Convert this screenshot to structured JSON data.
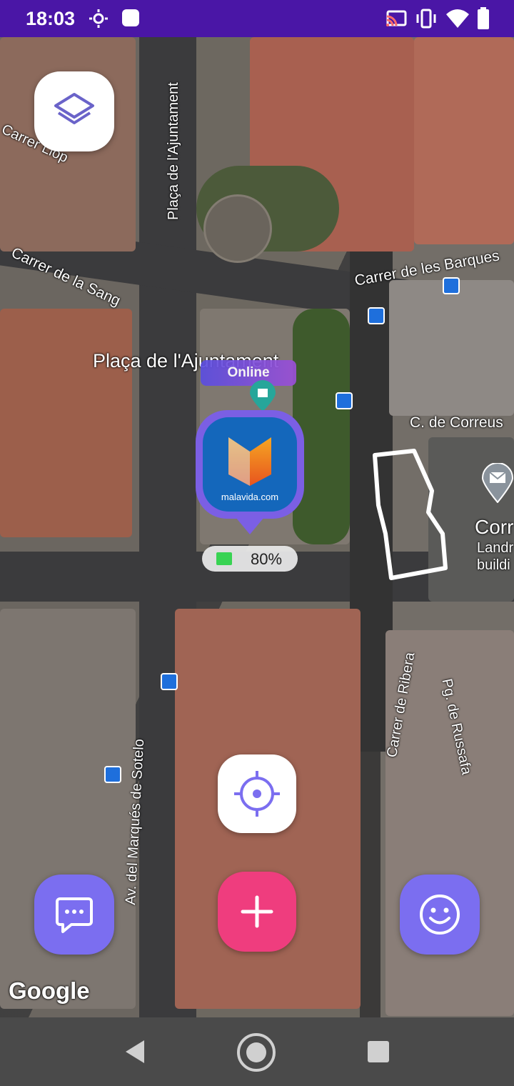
{
  "status_bar": {
    "time": "18:03"
  },
  "map": {
    "labels": {
      "carrer_llop": "Carrer   Llop",
      "placa_ajuntament_vertical": "Plaça de l'Ajuntament",
      "carrer_sang": "Carrer de la Sang",
      "carrer_barques": "Carrer de les Barques",
      "placa_ajuntament": "Plaça de l'Ajuntament",
      "c_correus": "C. de Correus",
      "correus_title": "Corr",
      "correus_sub1": "Landr",
      "correus_sub2": "buildi",
      "carrer_ribera": "Carrer de Ribera",
      "pg_russafa": "Pg. de Russafa",
      "av_sotelo": "Av. del Marqués de Sotelo"
    },
    "attribution": "Google"
  },
  "user_marker": {
    "status": "Online",
    "avatar_caption": "malavida.com",
    "battery": "80%"
  },
  "colors": {
    "status_bar": "#4a16a6",
    "accent": "#7b68ee",
    "fab_pink": "#ef3d7e",
    "online": "#8b5cf6"
  },
  "icons": {
    "layers": "layers-icon",
    "locate": "crosshair-icon",
    "chat": "chat-bubble-icon",
    "add": "plus-icon",
    "emoji": "smiley-icon"
  }
}
